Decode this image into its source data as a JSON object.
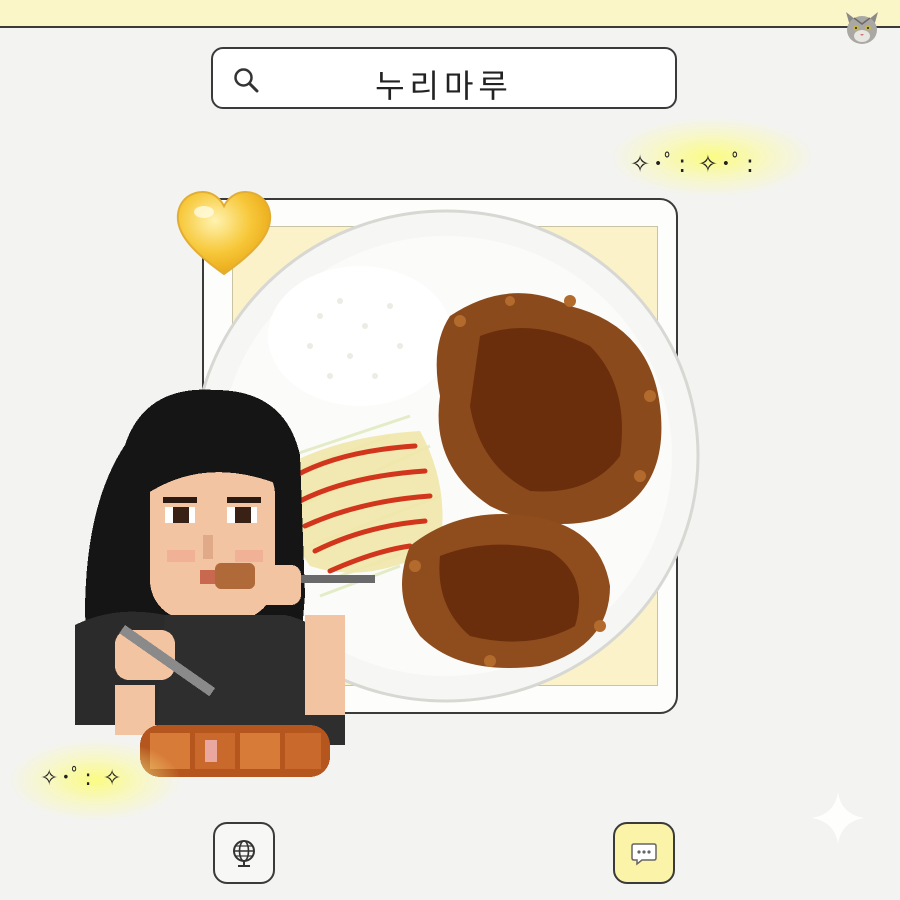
{
  "search": {
    "query": "누리마루"
  },
  "decorations": {
    "sparkle_top": "✧･ﾟ: ✧･ﾟ:",
    "sparkle_bottom": "✧･ﾟ: ✧"
  },
  "icons": {
    "search": "search-icon",
    "globe": "globe-icon",
    "chat": "chat-bubble-icon",
    "heart": "heart-icon",
    "avatar": "cat-avatar"
  },
  "colors": {
    "top_bar": "#fbf6c8",
    "border": "#3a3a3a",
    "photo_backdrop": "#fbf2c9",
    "chat_button": "#fbf3a7",
    "heart": "#f7c83a"
  }
}
